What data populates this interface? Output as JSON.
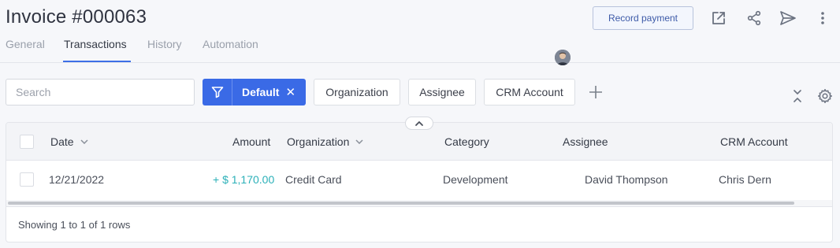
{
  "header": {
    "title": "Invoice #000063",
    "record_payment_label": "Record payment",
    "icons": [
      "external-link-icon",
      "share-icon",
      "send-icon",
      "more-vertical-icon"
    ]
  },
  "tabs": [
    {
      "label": "General",
      "active": false
    },
    {
      "label": "Transactions",
      "active": true
    },
    {
      "label": "History",
      "active": false
    },
    {
      "label": "Automation",
      "active": false
    }
  ],
  "toolbar": {
    "search_placeholder": "Search",
    "active_filter_label": "Default",
    "filter_chips": [
      "Organization",
      "Assignee",
      "CRM Account"
    ]
  },
  "table": {
    "columns": [
      "Date",
      "Amount",
      "Organization",
      "Category",
      "Assignee",
      "CRM Account"
    ],
    "rows": [
      {
        "date": "12/21/2022",
        "amount": "+ $ 1,170.00",
        "organization": "Credit Card",
        "category": "Development",
        "assignee": "David Thompson",
        "crm_account": "Chris Dern"
      }
    ],
    "footer_text": "Showing 1 to 1 of 1 rows"
  },
  "colors": {
    "accent": "#3a6ae6",
    "amount_positive": "#2bb0b8",
    "background": "#f6f7fa"
  }
}
